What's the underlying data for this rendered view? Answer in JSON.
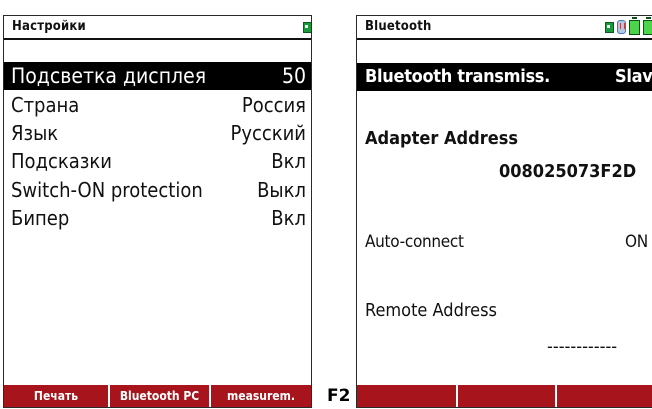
{
  "left_screen": {
    "title": "Настройки",
    "rows": [
      {
        "label": "Подсветка дисплея",
        "value": "50"
      },
      {
        "label": "Страна",
        "value": "Россия"
      },
      {
        "label": "Язык",
        "value": "Русский"
      },
      {
        "label": "Подсказки",
        "value": "Вкл"
      },
      {
        "label": "Switch-ON protection",
        "value": "Выкл"
      },
      {
        "label": "Бипер",
        "value": "Вкл"
      }
    ],
    "selected_row": 0,
    "softkeys": [
      "Печать",
      "Bluetooth PC",
      "measurem."
    ]
  },
  "right_screen": {
    "title": "Bluetooth",
    "transmission": {
      "label": "Bluetooth transmiss.",
      "value": "Slave"
    },
    "adapter_address": {
      "label": "Adapter Address",
      "value": "008025073F2D"
    },
    "auto_connect": {
      "label": "Auto-connect",
      "value": "ON"
    },
    "remote_address": {
      "label": "Remote Address",
      "value": "------------"
    },
    "softkeys": [
      "",
      "",
      ""
    ]
  },
  "key_label": "F2",
  "colors": {
    "softkey_bg": "#a8141c",
    "selection_bg": "#000000",
    "battery": "#4cd44c"
  },
  "icons": [
    "power-plug-icon",
    "bluetooth-icon",
    "battery-icon",
    "battery-icon"
  ]
}
